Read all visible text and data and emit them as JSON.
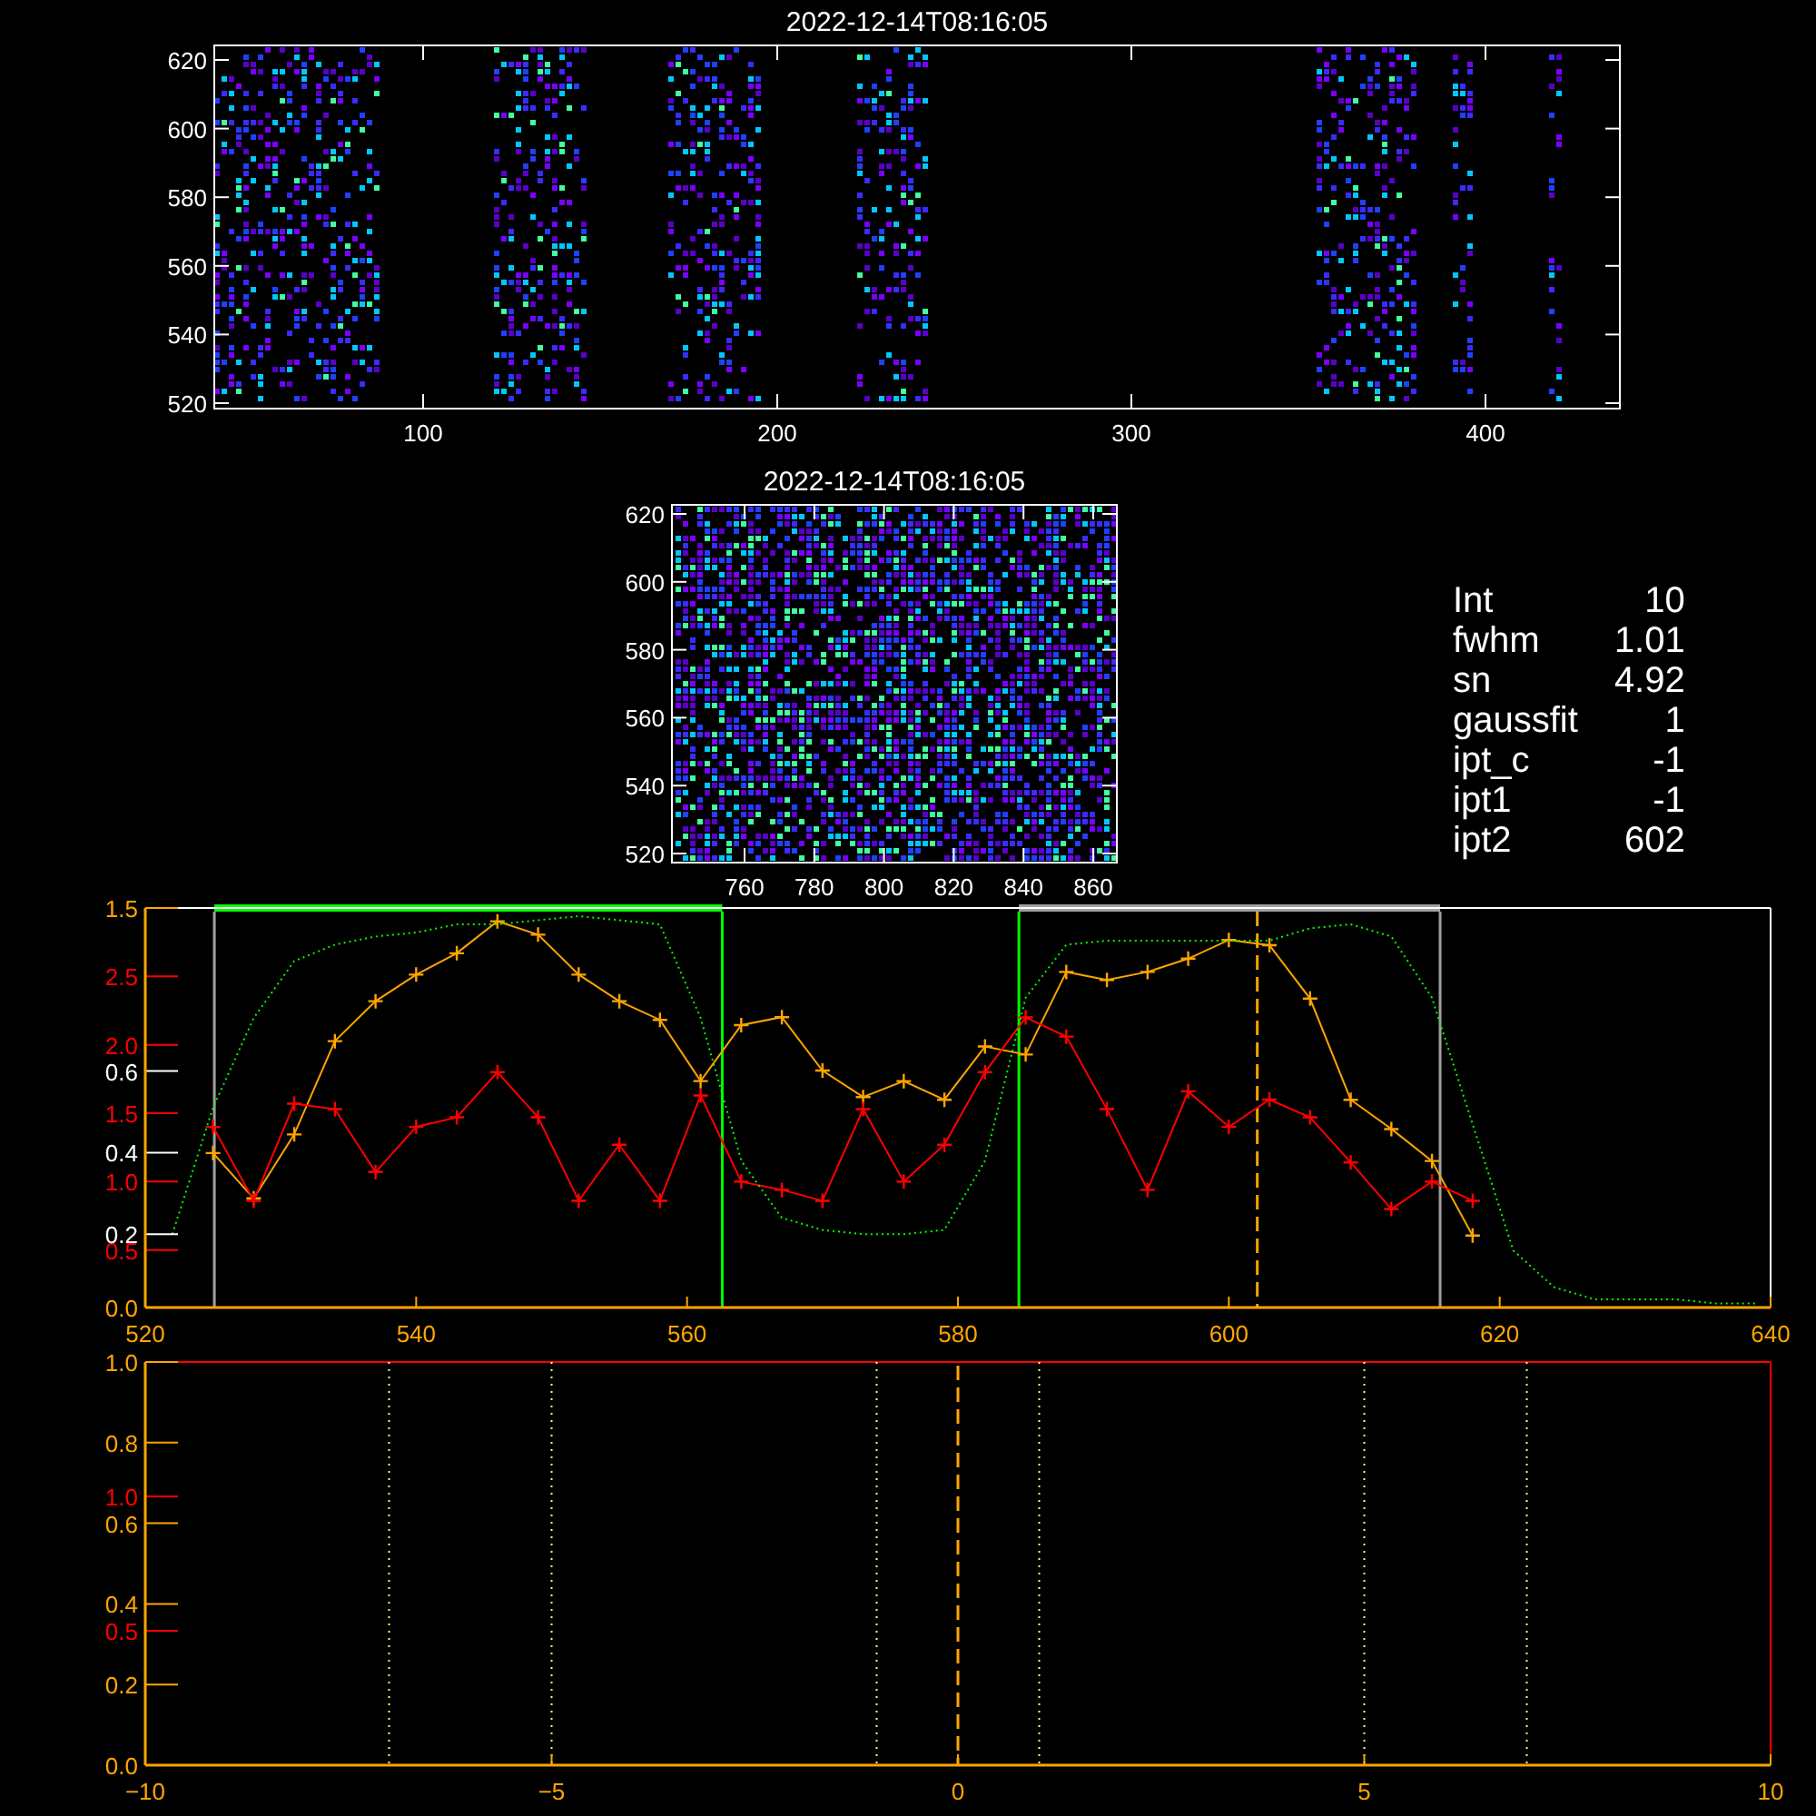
{
  "map_panels": [
    {
      "title": "2022-12-14T08:16:05",
      "xticks": [
        "100",
        "200",
        "300",
        "400"
      ],
      "yticks": [
        "620",
        "600",
        "580",
        "560",
        "540",
        "520"
      ]
    },
    {
      "title": "2022-12-14T08:16:05",
      "xticks": [
        "760",
        "780",
        "800",
        "820",
        "840",
        "860"
      ],
      "yticks": [
        "620",
        "600",
        "580",
        "560",
        "540",
        "520"
      ]
    }
  ],
  "fit_info": [
    {
      "label": "Int",
      "value": "10"
    },
    {
      "label": "fwhm",
      "value": "1.01"
    },
    {
      "label": "sn",
      "value": "4.92"
    },
    {
      "label": "gaussfit",
      "value": "1"
    },
    {
      "label": "ipt_c",
      "value": "-1"
    },
    {
      "label": "ipt1",
      "value": "-1"
    },
    {
      "label": "ipt2",
      "value": "602"
    }
  ],
  "profile": {
    "chart_data": {
      "type": "line",
      "xlim": [
        520,
        640
      ],
      "ylim": [
        0,
        1.5
      ],
      "xticks": [
        520,
        540,
        560,
        580,
        600,
        620,
        640
      ],
      "yticks": [
        {
          "value": 0,
          "label": "0.0"
        },
        {
          "value": 1.5,
          "label": "1.5"
        }
      ],
      "y2lim": [
        0.08,
        3.0
      ],
      "y2ticks": [
        {
          "value": 0.5,
          "label": "0.5"
        },
        {
          "value": 1.0,
          "label": "1.0"
        },
        {
          "value": 1.5,
          "label": "1.5"
        },
        {
          "value": 2.0,
          "label": "2.0"
        },
        {
          "value": 2.5,
          "label": "2.5"
        }
      ],
      "y3lim": [
        0.02,
        1.0
      ],
      "y3ticks": [
        {
          "value": 0.2,
          "label": "0.2"
        },
        {
          "value": 0.4,
          "label": "0.4"
        },
        {
          "value": 0.6,
          "label": "0.6"
        }
      ],
      "x": [
        522,
        525,
        528,
        531,
        534,
        537,
        540,
        543,
        546,
        549,
        552,
        555,
        558,
        561,
        564,
        567,
        570,
        573,
        576,
        579,
        582,
        585,
        588,
        591,
        594,
        597,
        600,
        603,
        606,
        609,
        612,
        615,
        618,
        621,
        624,
        627,
        630,
        633,
        636,
        639
      ],
      "series": [
        {
          "color": "#ffa500",
          "marker": "+",
          "values": [
            null,
            0.58,
            0.41,
            0.65,
            1.0,
            1.15,
            1.25,
            1.33,
            1.45,
            1.4,
            1.25,
            1.15,
            1.08,
            0.85,
            1.06,
            1.09,
            0.89,
            0.79,
            0.85,
            0.78,
            0.98,
            0.95,
            1.26,
            1.23,
            1.26,
            1.31,
            1.38,
            1.36,
            1.16,
            0.78,
            0.67,
            0.55,
            0.27,
            null,
            null,
            null,
            null,
            null,
            null,
            null
          ]
        },
        {
          "color": "#ff0000",
          "axis": "y2",
          "marker": "+",
          "values": [
            null,
            1.4,
            0.86,
            1.57,
            1.53,
            1.07,
            1.4,
            1.47,
            1.8,
            1.47,
            0.86,
            1.27,
            0.86,
            1.63,
            1.0,
            0.94,
            0.86,
            1.53,
            1.0,
            1.27,
            1.8,
            2.2,
            2.06,
            1.53,
            0.94,
            1.66,
            1.4,
            1.6,
            1.47,
            1.14,
            0.8,
            1.0,
            0.86,
            null,
            null,
            null,
            null,
            null,
            null,
            null
          ]
        },
        {
          "color": "#00ff00",
          "axis": "y3",
          "line_style": "dotted",
          "values": [
            0.2,
            0.51,
            0.73,
            0.87,
            0.91,
            0.93,
            0.94,
            0.96,
            0.96,
            0.97,
            0.98,
            0.97,
            0.96,
            0.73,
            0.38,
            0.24,
            0.21,
            0.2,
            0.2,
            0.21,
            0.38,
            0.78,
            0.91,
            0.92,
            0.92,
            0.92,
            0.92,
            0.92,
            0.95,
            0.96,
            0.93,
            0.78,
            0.47,
            0.16,
            0.07,
            0.04,
            0.04,
            0.04,
            0.03,
            0.03
          ]
        }
      ],
      "ref_lines": [
        {
          "axis": "x",
          "value": 525.1,
          "color": "#a0a0a0"
        },
        {
          "axis": "x",
          "value": 562.6,
          "color": "#00ff00"
        },
        {
          "axis": "x",
          "value": 584.5,
          "color": "#00ff00"
        },
        {
          "axis": "x",
          "value": 615.6,
          "color": "#a0a0a0"
        },
        {
          "axis": "x",
          "value": 602.1,
          "color": "#ffa500",
          "line_style": "dashed"
        }
      ]
    }
  },
  "lag_axes": {
    "xticks": [
      "−10",
      "−5",
      "0",
      "5",
      "10"
    ],
    "yticks": [
      "1.0",
      "0.8",
      "0.6",
      "0.4",
      "0.2",
      "0.0"
    ],
    "y2ticks": [
      "1.0",
      "0.5"
    ]
  }
}
